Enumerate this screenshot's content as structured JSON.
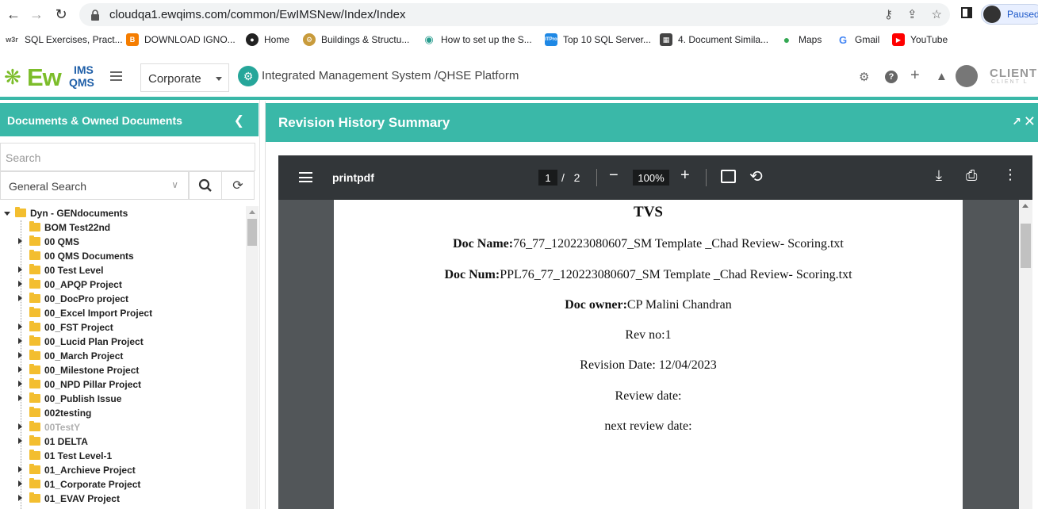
{
  "browser": {
    "url": "cloudqa1.ewqims.com/common/EwIMSNew/Index/Index",
    "profile_status": "Paused",
    "bookmarks": [
      {
        "label": "SQL Exercises, Pract...",
        "icon": "w3r"
      },
      {
        "label": "DOWNLOAD IGNO...",
        "icon": "B"
      },
      {
        "label": "Home",
        "icon": "globe"
      },
      {
        "label": "Buildings & Structu...",
        "icon": "gear"
      },
      {
        "label": "How to set up the S...",
        "icon": "eye"
      },
      {
        "label": "Top 10 SQL Server...",
        "icon": "ITPro"
      },
      {
        "label": "4. Document Simila...",
        "icon": "book"
      },
      {
        "label": "Maps",
        "icon": "map-pin"
      },
      {
        "label": "Gmail",
        "icon": "G"
      },
      {
        "label": "YouTube",
        "icon": "play"
      }
    ]
  },
  "header": {
    "logo_ew": "Ew",
    "logo_ims": "IMS",
    "logo_qms": "QMS",
    "org_select": "Corporate",
    "platform_title": "Integrated Management System /QHSE Platform",
    "client_label": "CLIENT L",
    "client_sub": "CLIENT L"
  },
  "left_panel": {
    "title": "Documents & Owned Documents",
    "search_placeholder": "Search",
    "search_type": "General Search",
    "tree_root": "Dyn - GENdocuments",
    "tree_items": [
      {
        "label": "BOM Test22nd",
        "expandable": false,
        "dim": false
      },
      {
        "label": "00 QMS",
        "expandable": true,
        "dim": false
      },
      {
        "label": "00 QMS Documents",
        "expandable": false,
        "dim": false
      },
      {
        "label": "00 Test Level",
        "expandable": true,
        "dim": false
      },
      {
        "label": "00_APQP Project",
        "expandable": true,
        "dim": false
      },
      {
        "label": "00_DocPro project",
        "expandable": true,
        "dim": false
      },
      {
        "label": "00_Excel Import Project",
        "expandable": false,
        "dim": false
      },
      {
        "label": "00_FST Project",
        "expandable": true,
        "dim": false
      },
      {
        "label": "00_Lucid Plan Project",
        "expandable": true,
        "dim": false
      },
      {
        "label": "00_March Project",
        "expandable": true,
        "dim": false
      },
      {
        "label": "00_Milestone Project",
        "expandable": true,
        "dim": false
      },
      {
        "label": "00_NPD Pillar Project",
        "expandable": true,
        "dim": false
      },
      {
        "label": "00_Publish Issue",
        "expandable": true,
        "dim": false
      },
      {
        "label": "002testing",
        "expandable": false,
        "dim": false
      },
      {
        "label": "00TestY",
        "expandable": true,
        "dim": true
      },
      {
        "label": "01 DELTA",
        "expandable": true,
        "dim": false
      },
      {
        "label": "01 Test Level-1",
        "expandable": false,
        "dim": false
      },
      {
        "label": "01_Archieve Project",
        "expandable": true,
        "dim": false
      },
      {
        "label": "01_Corporate Project",
        "expandable": true,
        "dim": false
      },
      {
        "label": "01_EVAV Project",
        "expandable": true,
        "dim": false
      }
    ]
  },
  "right_panel": {
    "title": "Revision History Summary"
  },
  "pdf_viewer": {
    "file_name": "printpdf",
    "current_page": "1",
    "page_sep": "/",
    "total_pages": "2",
    "zoom": "100%",
    "document": {
      "title": "TVS",
      "doc_name_label": "Doc Name:",
      "doc_name": "76_77_120223080607_SM Template _Chad Review- Scoring.txt",
      "doc_num_label": "Doc Num:",
      "doc_num": "PPL76_77_120223080607_SM Template _Chad Review- Scoring.txt",
      "doc_owner_label": "Doc owner:",
      "doc_owner": "CP Malini Chandran",
      "rev_no": "Rev no:1",
      "revision_date": "Revision Date: 12/04/2023",
      "review_date": "Review date:",
      "next_review_date": "next review date:"
    }
  },
  "colors": {
    "teal": "#3ab8a8",
    "pdf_toolbar": "#323639",
    "folder": "#f3be2f"
  }
}
